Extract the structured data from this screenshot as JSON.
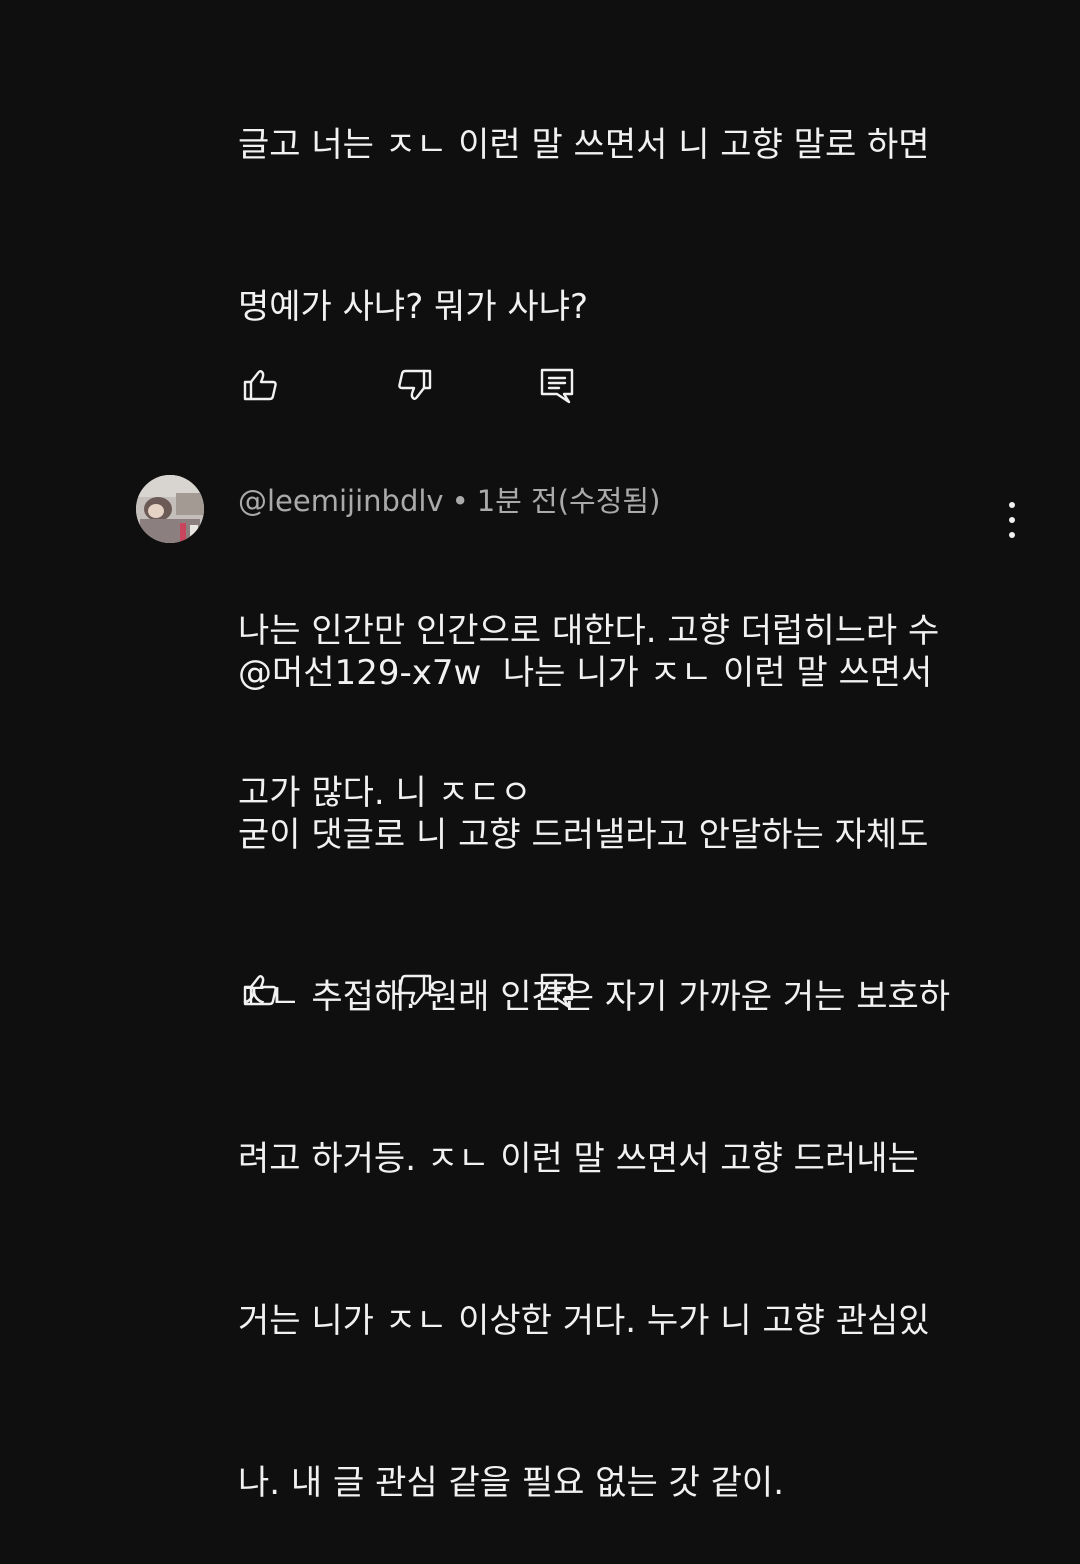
{
  "comment1": {
    "lines": [
      "글고 너는 ㅈㄴ 이런 말 쓰면서 니 고향 말로 하면",
      "명예가 사냐? 뭐가 사냐?",
      "",
      "나는 인간만 인간으로 대한다. 고향 더럽히느라 수",
      "고가 많다. 니 ㅈㄷㅇ"
    ]
  },
  "comment2": {
    "author": "@leemijinbdlv",
    "separator": "•",
    "meta": "1분 전(수정됨)",
    "lines": [
      "@머선129-x7w  나는 니가 ㅈㄴ 이런 말 쓰면서",
      "굳이 댓글로 니 고향 드러낼라고 안달하는 자체도",
      "ㅈㄴ 추접해. 원래 인간은 자기 가까운 거는 보호하",
      "려고 하거등. ㅈㄴ 이런 말 쓰면서 고향 드러내는",
      "거는 니가 ㅈㄴ 이상한 거다. 누가 니 고향 관심있",
      "나. 내 글 관심 같을 필요 없는 갓 같이."
    ]
  },
  "icons": {
    "like": "thumbs-up-icon",
    "dislike": "thumbs-down-icon",
    "reply": "reply-comment-icon",
    "more": "vertical-dots-icon"
  }
}
